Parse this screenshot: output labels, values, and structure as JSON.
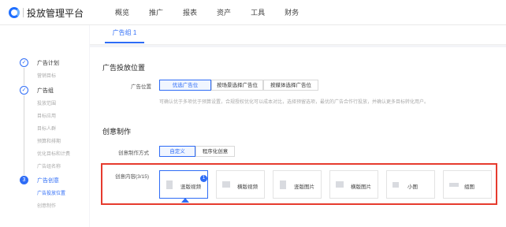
{
  "header": {
    "brand": "投放管理平台",
    "nav": [
      "概览",
      "推广",
      "报表",
      "资产",
      "工具",
      "财务"
    ]
  },
  "tabs": [
    "广告组 1"
  ],
  "sidebar": {
    "steps": [
      {
        "label": "广告计划",
        "sub": [
          "营销目标"
        ]
      },
      {
        "label": "广告组",
        "sub": [
          "投放范围",
          "目标应用",
          "目标人群",
          "预算和排期",
          "优化目标和计费",
          "广告组名称"
        ]
      },
      {
        "label": "广告创意",
        "number": "3",
        "sub": [
          "广告投放位置",
          "创意制作"
        ]
      }
    ]
  },
  "placement": {
    "title": "广告投放位置",
    "label": "广告位置",
    "options": [
      "优选广告位",
      "按场景选择广告位",
      "按媒体选择广告位"
    ],
    "selected": "优选广告位",
    "hint": "可确认优于多项优于预算设置，合规授权优化可以成本对比，选择预留选项，最优的广告合作行投放，并确认更多目标转化用户。"
  },
  "creative": {
    "title": "创意制作",
    "mode_label": "创意制作方式",
    "modes": [
      "自定义",
      "程序化创意"
    ],
    "content_label": "创意内容(3/15)",
    "formats": [
      {
        "label": "竖版视频",
        "badge": "1"
      },
      {
        "label": "横版视频"
      },
      {
        "label": "竖版图片"
      },
      {
        "label": "横版图片"
      },
      {
        "label": "小图"
      },
      {
        "label": "组图"
      }
    ]
  },
  "colors": {
    "accent": "#2e6cf6",
    "highlight": "#e63b2e"
  }
}
